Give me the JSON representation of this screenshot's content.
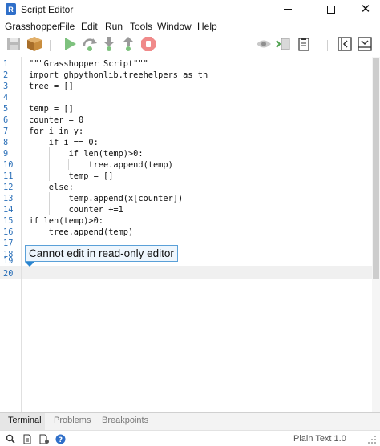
{
  "window": {
    "title": "Script Editor"
  },
  "menu": [
    "Grasshopper",
    "File",
    "Edit",
    "Run",
    "Tools",
    "Window",
    "Help"
  ],
  "toolbar": {
    "left_icons": [
      "save-icon",
      "package-icon",
      "run-icon",
      "run-from-here-icon",
      "step-into-icon",
      "step-out-icon",
      "stop-icon"
    ],
    "right_icons": [
      "eye-icon",
      "variable-explorer-icon",
      "clipboard-icon",
      "collapse-left-icon",
      "expand-down-icon"
    ]
  },
  "editor": {
    "lines": [
      {
        "n": "1",
        "code": "\"\"\"Grasshopper Script\"\"\""
      },
      {
        "n": "2",
        "code": "import ghpythonlib.treehelpers as th"
      },
      {
        "n": "3",
        "code": "tree = []"
      },
      {
        "n": "4",
        "code": ""
      },
      {
        "n": "5",
        "code": "temp = []"
      },
      {
        "n": "6",
        "code": "counter = 0"
      },
      {
        "n": "7",
        "code": "for i in y:"
      },
      {
        "n": "8",
        "code": "    if i == 0:"
      },
      {
        "n": "9",
        "code": "        if len(temp)>0:"
      },
      {
        "n": "10",
        "code": "            tree.append(temp)"
      },
      {
        "n": "11",
        "code": "        temp = []"
      },
      {
        "n": "12",
        "code": "    else:"
      },
      {
        "n": "13",
        "code": "        temp.append(x[counter])"
      },
      {
        "n": "14",
        "code": "        counter +=1"
      },
      {
        "n": "15",
        "code": "if len(temp)>0:"
      },
      {
        "n": "16",
        "code": "    tree.append(temp)"
      },
      {
        "n": "17",
        "code": ""
      },
      {
        "n": "18",
        "code": ""
      },
      {
        "n": "19",
        "code": ""
      },
      {
        "n": "20",
        "code": ""
      }
    ],
    "tooltip": "Cannot edit in read-only editor"
  },
  "bottom_tabs": [
    "Terminal",
    "Problems",
    "Breakpoints"
  ],
  "status": {
    "language": "Plain Text 1.0",
    "icons": [
      "search-icon",
      "document-icon",
      "document-settings-icon",
      "help-icon"
    ]
  }
}
